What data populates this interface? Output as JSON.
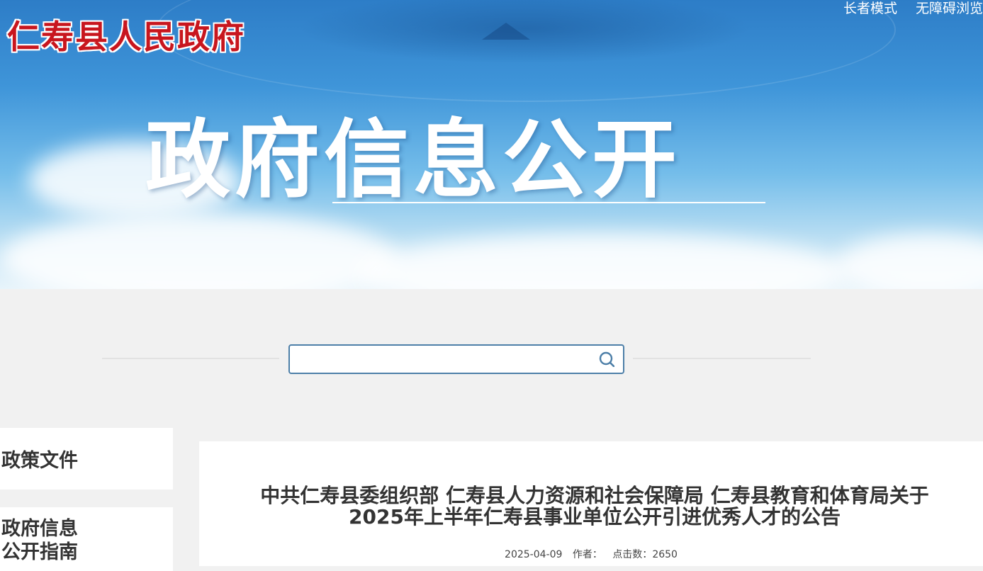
{
  "header": {
    "site_title": "仁寿县人民政府",
    "links": [
      "长者模式",
      "无障碍浏览"
    ],
    "banner_heading": "政府信息公开"
  },
  "search": {
    "placeholder": "",
    "value": ""
  },
  "sidebar": {
    "items": [
      {
        "line1": "政策文件",
        "line2": ""
      },
      {
        "line1": "政府信息",
        "line2": "公开指南"
      }
    ]
  },
  "article": {
    "title_line1": "中共仁寿县委组织部 仁寿县人力资源和社会保障局 仁寿县教育和体育局关于",
    "title_line2": "2025年上半年仁寿县事业单位公开引进优秀人才的公告",
    "date": "2025-04-09",
    "author_label": "作者：",
    "views_label": "点击数：",
    "views": "2650"
  },
  "colors": {
    "title_red": "#c8161e",
    "search_border": "#4d7fa8",
    "text_dark": "#333333"
  }
}
